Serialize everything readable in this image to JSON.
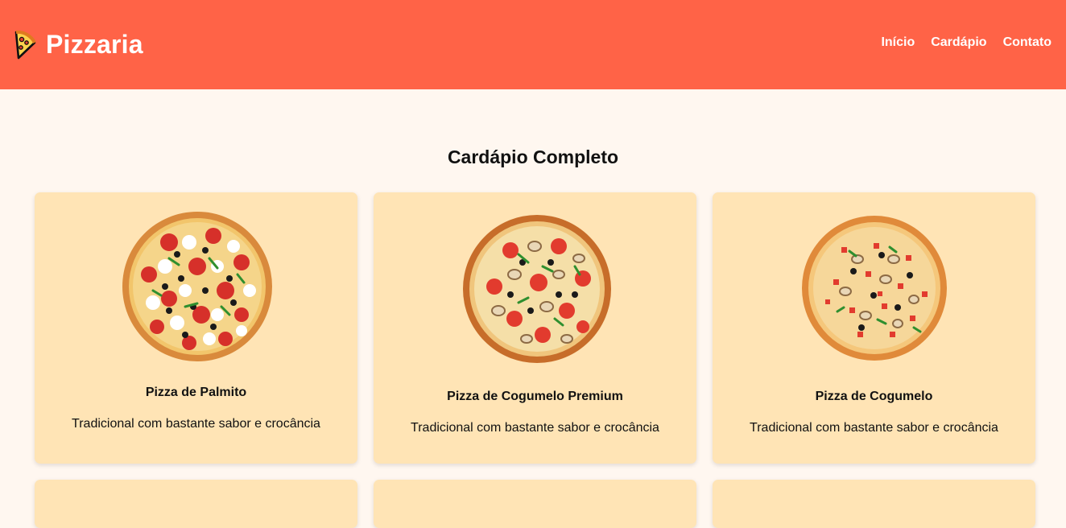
{
  "header": {
    "brand_title": "Pizzaria",
    "brand_icon": "pizza-slice-icon",
    "nav": [
      {
        "label": "Início"
      },
      {
        "label": "Cardápio"
      },
      {
        "label": "Contato"
      }
    ],
    "bg_color": "#ff6347"
  },
  "menu": {
    "title": "Cardápio Completo",
    "items": [
      {
        "name": "Pizza de Palmito",
        "description": "Tradicional com bastante sabor e crocância",
        "image": "pizza-image"
      },
      {
        "name": "Pizza de Cogumelo Premium",
        "description": "Tradicional com bastante sabor e crocância",
        "image": "pizza-image"
      },
      {
        "name": "Pizza de Cogumelo",
        "description": "Tradicional com bastante sabor e crocância",
        "image": "pizza-image"
      }
    ]
  }
}
